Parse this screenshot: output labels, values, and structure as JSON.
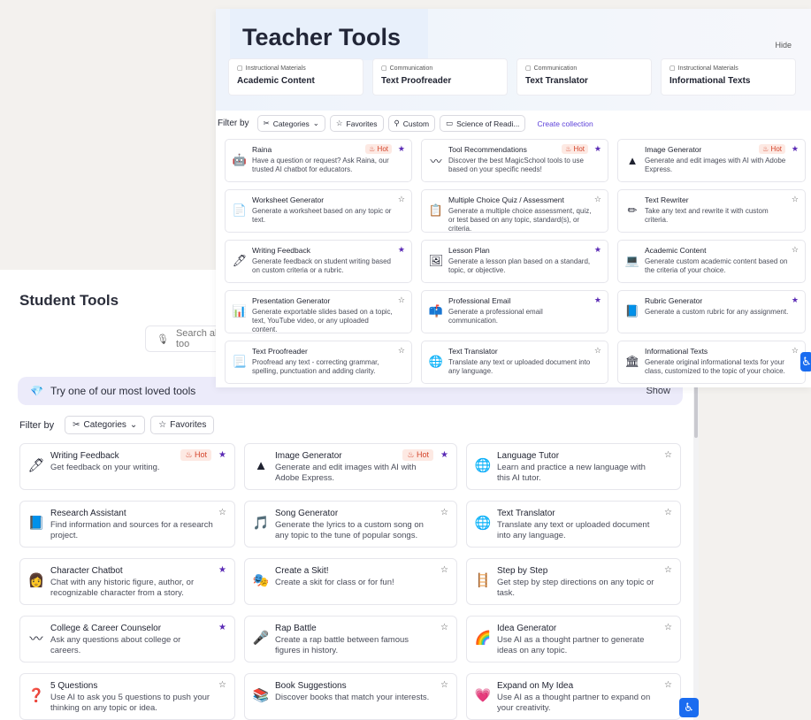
{
  "teacher": {
    "title": "Teacher Tools",
    "hide_label": "Hide",
    "quick": [
      {
        "category": "Instructional Materials",
        "name": "Academic Content"
      },
      {
        "category": "Communication",
        "name": "Text Proofreader"
      },
      {
        "category": "Communication",
        "name": "Text Translator"
      },
      {
        "category": "Instructional Materials",
        "name": "Informational Texts"
      }
    ],
    "filter": {
      "label": "Filter by",
      "categories": "Categories",
      "favorites": "Favorites",
      "custom": "Custom",
      "collection": "Science of Readi...",
      "create": "Create collection"
    },
    "hot_label": "Hot",
    "tools": [
      {
        "name": "Raina",
        "desc": "Have a question or request? Ask Raina, our trusted AI chatbot for educators.",
        "icon": "robot-icon",
        "glyph": "🤖",
        "hot": true,
        "fav": true
      },
      {
        "name": "Tool Recommendations",
        "desc": "Discover the best MagicSchool tools to use based on your specific needs!",
        "icon": "winding-path-icon",
        "glyph": "〰",
        "hot": true,
        "fav": true
      },
      {
        "name": "Image Generator",
        "desc": "Generate and edit images with AI with Adobe Express.",
        "icon": "adobe-express-icon",
        "glyph": "▲",
        "hot": true,
        "fav": true
      },
      {
        "name": "Worksheet Generator",
        "desc": "Generate a worksheet based on any topic or text.",
        "icon": "worksheet-icon",
        "glyph": "📄",
        "hot": false,
        "fav": false
      },
      {
        "name": "Multiple Choice Quiz / Assessment",
        "desc": "Generate a multiple choice assessment, quiz, or test based on any topic, standard(s), or criteria.",
        "icon": "quiz-icon",
        "glyph": "📋",
        "hot": false,
        "fav": false
      },
      {
        "name": "Text Rewriter",
        "desc": "Take any text and rewrite it with custom criteria.",
        "icon": "pencil-icon",
        "glyph": "✏",
        "hot": false,
        "fav": false
      },
      {
        "name": "Writing Feedback",
        "desc": "Generate feedback on student writing based on custom criteria or a rubric.",
        "icon": "pen-icon",
        "glyph": "🖊",
        "hot": false,
        "fav": true
      },
      {
        "name": "Lesson Plan",
        "desc": "Generate a lesson plan based on a standard, topic, or objective.",
        "icon": "chalkboard-icon",
        "glyph": "🖼",
        "hot": false,
        "fav": true
      },
      {
        "name": "Academic Content",
        "desc": "Generate custom academic content based on the criteria of your choice.",
        "icon": "laptop-icon",
        "glyph": "💻",
        "hot": false,
        "fav": false
      },
      {
        "name": "Presentation Generator",
        "desc": "Generate exportable slides based on a topic, text, YouTube video, or any uploaded content.",
        "icon": "presentation-icon",
        "glyph": "📊",
        "hot": false,
        "fav": false
      },
      {
        "name": "Professional Email",
        "desc": "Generate a professional email communication.",
        "icon": "mailbox-icon",
        "glyph": "📫",
        "hot": false,
        "fav": true
      },
      {
        "name": "Rubric Generator",
        "desc": "Generate a custom rubric for any assignment.",
        "icon": "rubric-icon",
        "glyph": "📘",
        "hot": false,
        "fav": true
      },
      {
        "name": "Text Proofreader",
        "desc": "Proofread any text - correcting grammar, spelling, punctuation and adding clarity.",
        "icon": "document-icon",
        "glyph": "📃",
        "hot": false,
        "fav": false
      },
      {
        "name": "Text Translator",
        "desc": "Translate any text or uploaded document into any language.",
        "icon": "globe-icon",
        "glyph": "🌐",
        "hot": false,
        "fav": false
      },
      {
        "name": "Informational Texts",
        "desc": "Generate original informational texts for your class, customized to the topic of your choice.",
        "icon": "library-icon",
        "glyph": "🏛",
        "hot": false,
        "fav": false
      }
    ]
  },
  "student": {
    "title": "Student Tools",
    "search_placeholder": "Search all too",
    "loved": "Try one of our most loved tools",
    "show_label": "Show",
    "filter": {
      "label": "Filter by",
      "categories": "Categories",
      "favorites": "Favorites"
    },
    "hot_label": "Hot",
    "tools": [
      {
        "name": "Writing Feedback",
        "desc": "Get feedback on your writing.",
        "icon": "pen-icon",
        "glyph": "🖊",
        "hot": true,
        "fav": true
      },
      {
        "name": "Image Generator",
        "desc": "Generate and edit images with AI with Adobe Express.",
        "icon": "adobe-express-icon",
        "glyph": "▲",
        "hot": true,
        "fav": true
      },
      {
        "name": "Language Tutor",
        "desc": "Learn and practice a new language with this AI tutor.",
        "icon": "globe-icon",
        "glyph": "🌐",
        "hot": false,
        "fav": false
      },
      {
        "name": "Research Assistant",
        "desc": "Find information and sources for a research project.",
        "icon": "book-icon",
        "glyph": "📘",
        "hot": false,
        "fav": false
      },
      {
        "name": "Song Generator",
        "desc": "Generate the lyrics to a custom song on any topic to the tune of popular songs.",
        "icon": "music-note-icon",
        "glyph": "🎵",
        "hot": false,
        "fav": false
      },
      {
        "name": "Text Translator",
        "desc": "Translate any text or uploaded document into any language.",
        "icon": "globe-icon",
        "glyph": "🌐",
        "hot": false,
        "fav": false
      },
      {
        "name": "Character Chatbot",
        "desc": "Chat with any historic figure, author, or recognizable character from a story.",
        "icon": "character-icon",
        "glyph": "👩",
        "hot": false,
        "fav": true
      },
      {
        "name": "Create a Skit!",
        "desc": "Create a skit for class or for fun!",
        "icon": "theater-icon",
        "glyph": "🎭",
        "hot": false,
        "fav": false
      },
      {
        "name": "Step by Step",
        "desc": "Get step by step directions on any topic or task.",
        "icon": "steps-icon",
        "glyph": "🪜",
        "hot": false,
        "fav": false
      },
      {
        "name": "College & Career Counselor",
        "desc": "Ask any questions about college or careers.",
        "icon": "winding-path-icon",
        "glyph": "〰",
        "hot": false,
        "fav": true
      },
      {
        "name": "Rap Battle",
        "desc": "Create a rap battle between famous figures in history.",
        "icon": "microphone-icon",
        "glyph": "🎤",
        "hot": false,
        "fav": false
      },
      {
        "name": "Idea Generator",
        "desc": "Use AI as a thought partner to generate ideas on any topic.",
        "icon": "rainbow-icon",
        "glyph": "🌈",
        "hot": false,
        "fav": false
      },
      {
        "name": "5 Questions",
        "desc": "Use AI to ask you 5 questions to push your thinking on any topic or idea.",
        "icon": "question-figure-icon",
        "glyph": "❓",
        "hot": false,
        "fav": false
      },
      {
        "name": "Book Suggestions",
        "desc": "Discover books that match your interests.",
        "icon": "books-icon",
        "glyph": "📚",
        "hot": false,
        "fav": false
      },
      {
        "name": "Expand on My Idea",
        "desc": "Use AI as a thought partner to expand on your creativity.",
        "icon": "heart-plant-icon",
        "glyph": "💗",
        "hot": false,
        "fav": false
      }
    ]
  }
}
